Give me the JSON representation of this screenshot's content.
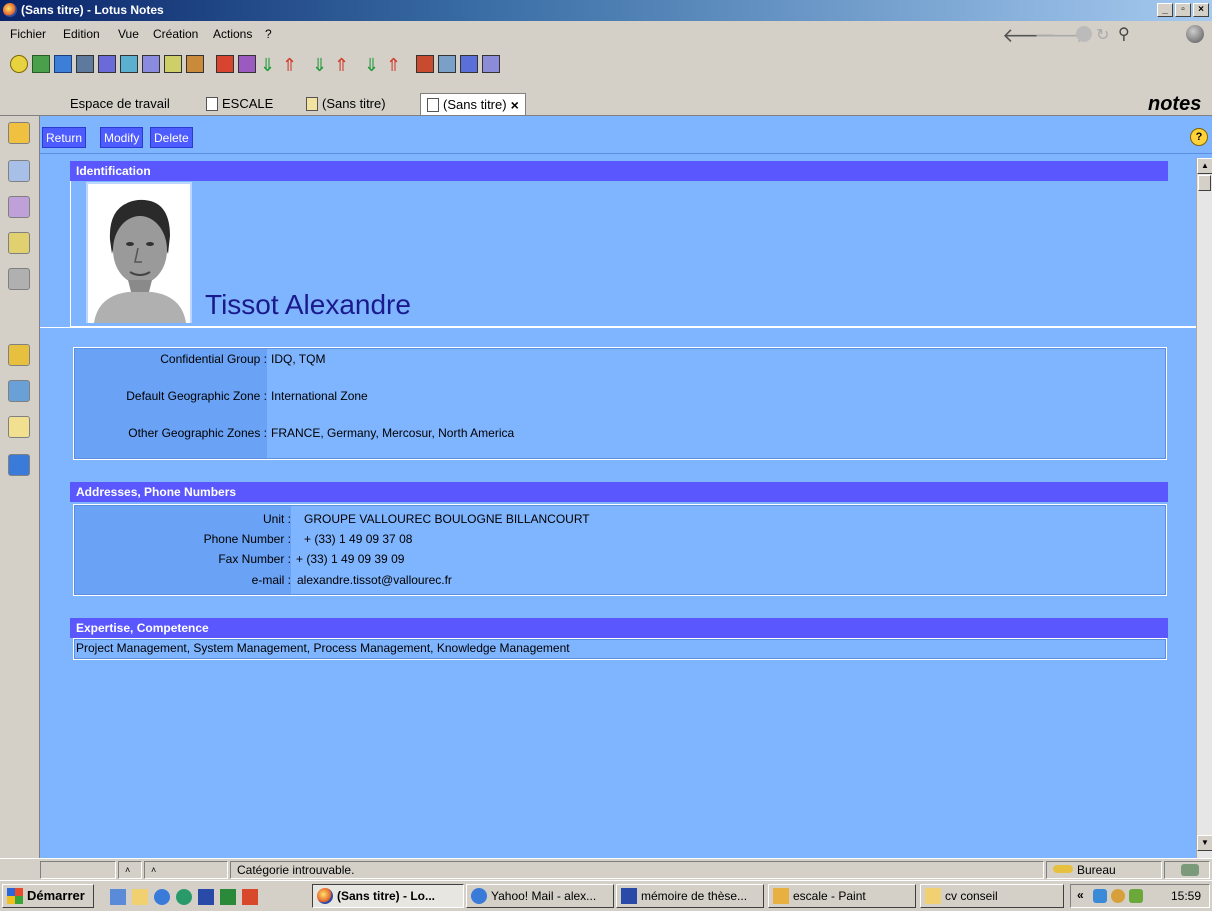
{
  "window": {
    "title": "(Sans titre) - Lotus Notes"
  },
  "menubar": {
    "items": [
      "Fichier",
      "Edition",
      "Vue",
      "Création",
      "Actions",
      "?"
    ]
  },
  "tabs": [
    {
      "label": "Espace de travail"
    },
    {
      "label": "ESCALE"
    },
    {
      "label": "(Sans titre)"
    },
    {
      "label": "(Sans titre)",
      "close": "×"
    }
  ],
  "brand": {
    "logo": "notes"
  },
  "actions": {
    "return_label": "Return",
    "modify_label": "Modify",
    "delete_label": "Delete"
  },
  "identification": {
    "header": "Identification",
    "name": "Tissot Alexandre",
    "fields": [
      {
        "label": "Confidential Group :",
        "value": "IDQ, TQM"
      },
      {
        "label": "Default Geographic Zone :",
        "value": "International Zone"
      },
      {
        "label": "Other Geographic Zones :",
        "value": "FRANCE, Germany, Mercosur, North America"
      }
    ]
  },
  "addresses": {
    "header": "Addresses, Phone Numbers",
    "fields": [
      {
        "label": "Unit :",
        "value": "GROUPE VALLOUREC BOULOGNE BILLANCOURT"
      },
      {
        "label": "Phone Number :",
        "value": "+ (33) 1 49 09 37 08"
      },
      {
        "label": "Fax Number :",
        "value": "+ (33) 1 49 09 39 09"
      },
      {
        "label": "e-mail :",
        "value": "alexandre.tissot@vallourec.fr"
      }
    ]
  },
  "expertise": {
    "header": "Expertise, Competence",
    "value": "Project Management, System Management, Process Management, Knowledge Management"
  },
  "statusbar": {
    "message": "Catégorie introuvable.",
    "location": "Bureau"
  },
  "taskbar": {
    "start_label": "Démarrer",
    "tasks": [
      {
        "label": "(Sans titre) - Lo..."
      },
      {
        "label": "Yahoo! Mail - alex..."
      },
      {
        "label": "mémoire de thèse..."
      },
      {
        "label": "escale - Paint"
      },
      {
        "label": "cv conseil"
      }
    ],
    "clock": "15:59"
  },
  "colors": {
    "content_bg": "#7fb4ff",
    "section_header": "#5b57ff",
    "action_button": "#4d5cff"
  }
}
